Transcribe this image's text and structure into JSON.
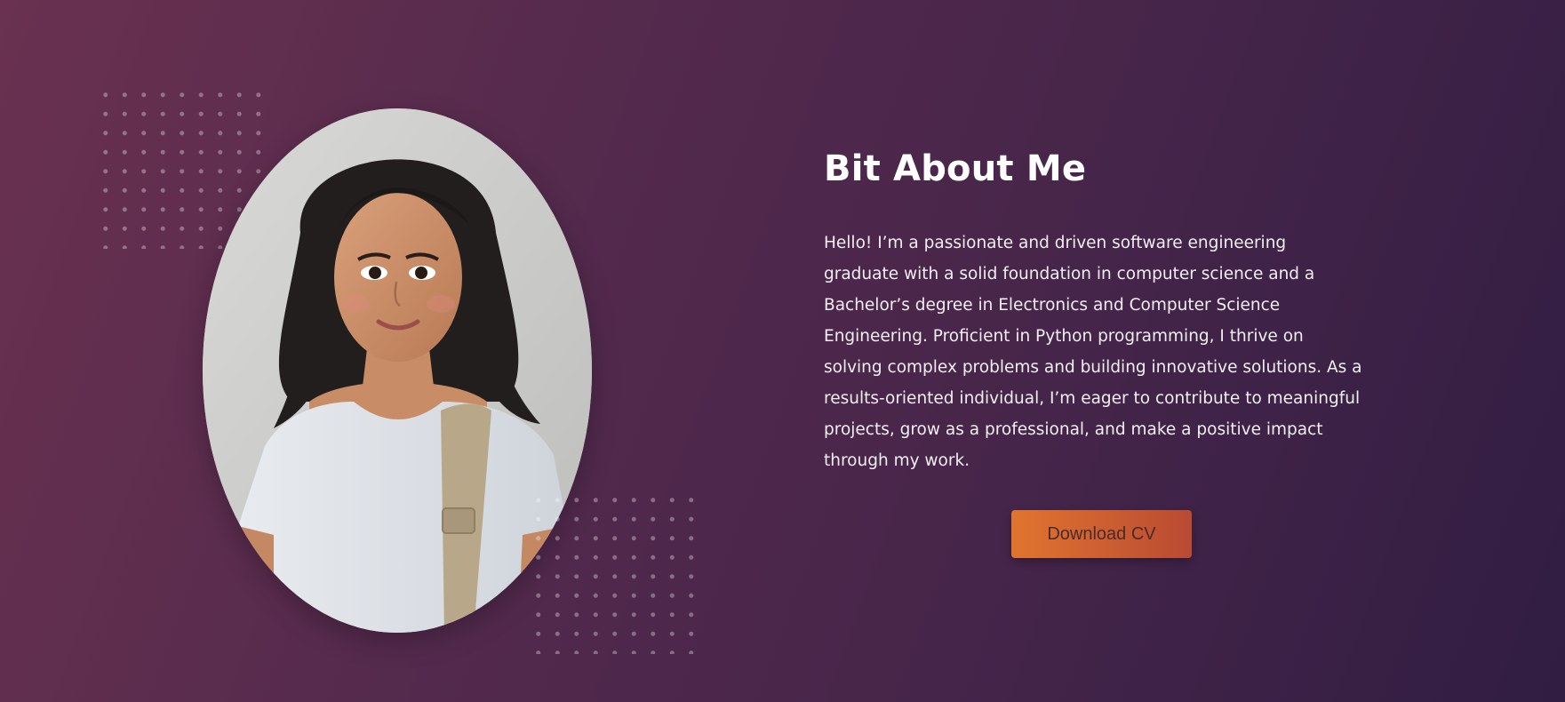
{
  "about": {
    "title": "Bit About Me",
    "bio": "Hello! I’m a passionate and driven software engineering graduate with a solid foundation in computer science and a Bachelor’s degree in Electronics and Computer Science Engineering. Proficient in Python programming, I thrive on solving complex problems and building innovative solutions. As a results-oriented individual, I’m eager to contribute to meaningful projects, grow as a professional, and make a positive impact through my work.",
    "download_label": "Download CV"
  },
  "colors": {
    "background_start": "#6a3150",
    "background_end": "#311d42",
    "button_start": "#e0752f",
    "button_end": "#b94a33"
  },
  "icons": {
    "portrait": "profile-portrait-image",
    "decor": "dot-grid-pattern"
  }
}
